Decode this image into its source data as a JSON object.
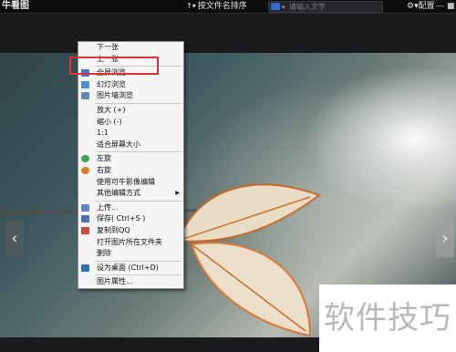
{
  "app": {
    "title": "牛看图"
  },
  "toolbar": {
    "sort_label": "按文件名排序",
    "search_placeholder": "请输入文字",
    "settings_label": "配置",
    "minimize": "—",
    "close": "■"
  },
  "context_menu": {
    "items": [
      {
        "label": "下一张",
        "icon": "none"
      },
      {
        "label": "上一张",
        "icon": "none",
        "highlighted": true
      },
      {
        "label": "全屏浏览",
        "icon": "fullscreen-icon"
      },
      {
        "label": "幻灯浏览",
        "icon": "slideshow-icon"
      },
      {
        "label": "图片墙浏览",
        "icon": "grid-icon"
      },
      {
        "label": "放大 (+)",
        "icon": "none"
      },
      {
        "label": "缩小 (-)",
        "icon": "none"
      },
      {
        "label": "1:1",
        "icon": "none"
      },
      {
        "label": "适合屏幕大小",
        "icon": "none"
      },
      {
        "label": "左旋",
        "icon": "rotate-left-icon"
      },
      {
        "label": "右旋",
        "icon": "rotate-right-icon"
      },
      {
        "label": "使用可牛影像编辑",
        "icon": "none"
      },
      {
        "label": "其他编辑方式",
        "icon": "none",
        "submenu": true
      },
      {
        "label": "上传...",
        "icon": "upload-icon"
      },
      {
        "label": "保存( Ctrl+S )",
        "icon": "save-icon"
      },
      {
        "label": "复制到QQ",
        "icon": "qq-icon"
      },
      {
        "label": "打开图片所在文件夹",
        "icon": "none"
      },
      {
        "label": "删除",
        "icon": "none"
      },
      {
        "label": "设为桌面     (Ctrl+D)",
        "icon": "desktop-icon"
      },
      {
        "label": "图片属性...",
        "icon": "none"
      }
    ]
  },
  "navigation": {
    "prev": "‹",
    "next": "›"
  },
  "watermark": {
    "text": "软件技巧"
  },
  "colors": {
    "highlight_border": "#e03030",
    "menu_bg": "#f5f5f5",
    "topbar_bg": "#0d0d0e"
  }
}
